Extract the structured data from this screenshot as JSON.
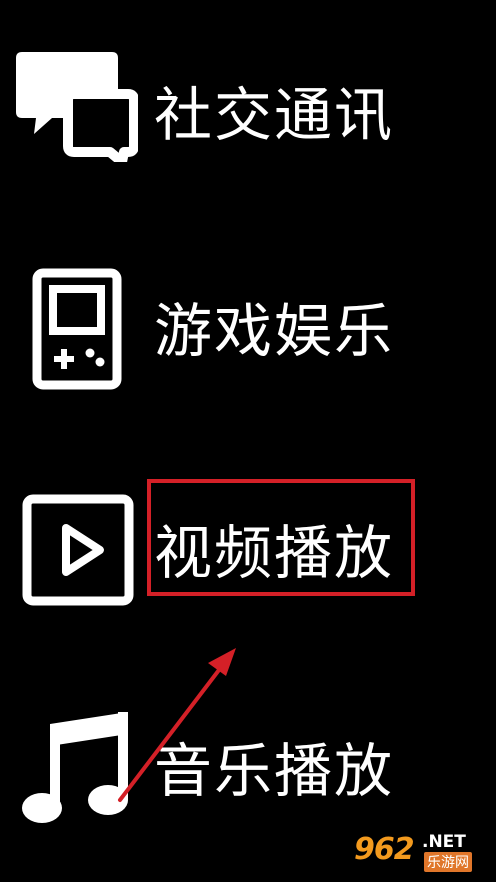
{
  "menu": {
    "items": [
      {
        "label": "社交通讯",
        "icon": "chat-bubbles-icon"
      },
      {
        "label": "游戏娱乐",
        "icon": "handheld-game-icon"
      },
      {
        "label": "视频播放",
        "icon": "video-play-icon"
      },
      {
        "label": "音乐播放",
        "icon": "music-note-icon"
      }
    ]
  },
  "annotation": {
    "highlighted_item": "视频播放",
    "color": "#d42027"
  },
  "watermark": {
    "logo": "962",
    "suffix": ".NET",
    "site": "乐游网"
  },
  "colors": {
    "background": "#000000",
    "foreground": "#ffffff",
    "accent": "#d42027"
  }
}
